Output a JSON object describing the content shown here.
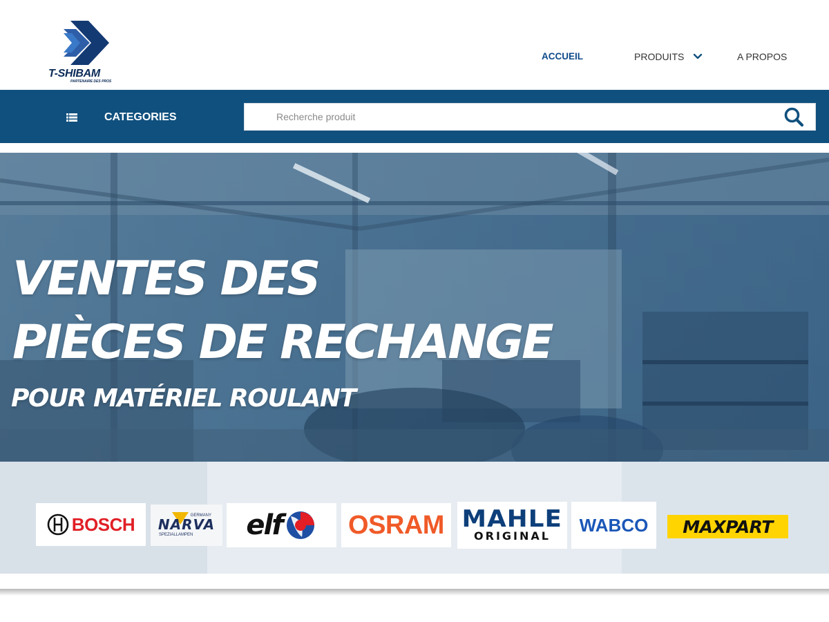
{
  "brand": {
    "name": "T-SHIBAM",
    "tagline": "PARTENAIRE DES PROS",
    "primary_color": "#10507e",
    "accent_color": "#0d4a8a"
  },
  "nav": {
    "items": [
      {
        "label": "ACCUEIL",
        "active": true
      },
      {
        "label": "PRODUITS",
        "has_dropdown": true
      },
      {
        "label": "A PROPOS"
      }
    ]
  },
  "catbar": {
    "categories_label": "CATEGORIES",
    "search_placeholder": "Recherche produit",
    "search_value": ""
  },
  "hero": {
    "line1": "VENTES DES",
    "line2": "PIÈCES DE RECHANGE",
    "line3": "POUR MATÉRIEL ROULANT"
  },
  "brands": [
    {
      "name": "BOSCH",
      "icon": "bosch-logo"
    },
    {
      "name": "NARVA",
      "sub_top": "GERMANY",
      "sub_bottom": "SPEZIALLAMPEN",
      "icon": "narva-logo"
    },
    {
      "name": "elf",
      "icon": "elf-logo"
    },
    {
      "name": "OSRAM",
      "icon": "osram-logo"
    },
    {
      "name": "MAHLE",
      "sub": "ORIGINAL",
      "icon": "mahle-logo"
    },
    {
      "name": "WABCO",
      "icon": "wabco-logo"
    },
    {
      "name": "MAXPART",
      "icon": "maxpart-logo"
    }
  ]
}
